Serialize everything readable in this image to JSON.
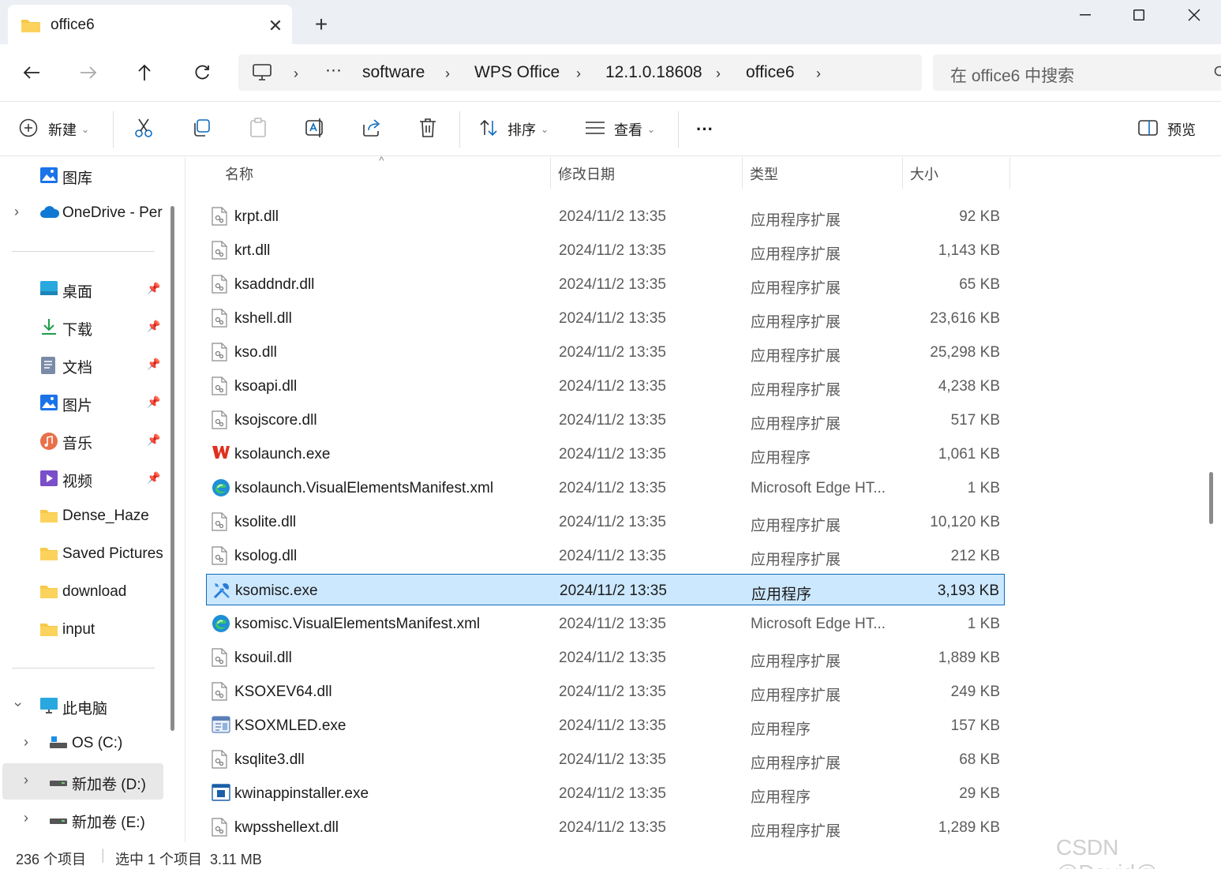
{
  "window": {
    "tab_title": "office6",
    "tab_close": "✕",
    "new_tab": "+"
  },
  "address": {
    "overflow": "···",
    "crumbs": [
      "software",
      "WPS Office",
      "12.1.0.18608",
      "office6"
    ],
    "search_placeholder": "在 office6 中搜索"
  },
  "commands": {
    "new": "新建",
    "sort": "排序",
    "view": "查看",
    "more": "···",
    "preview": "预览"
  },
  "sidebar": {
    "gallery": "图库",
    "onedrive": "OneDrive - Per",
    "quick": [
      {
        "label": "桌面",
        "icon": "desktop-icon"
      },
      {
        "label": "下载",
        "icon": "download-icon"
      },
      {
        "label": "文档",
        "icon": "document-icon"
      },
      {
        "label": "图片",
        "icon": "pictures-icon"
      },
      {
        "label": "音乐",
        "icon": "music-icon"
      },
      {
        "label": "视频",
        "icon": "video-icon"
      }
    ],
    "folders": [
      "Dense_Haze",
      "Saved Pictures",
      "download",
      "input"
    ],
    "this_pc": "此电脑",
    "drives": [
      "OS (C:)",
      "新加卷 (D:)",
      "新加卷 (E:)"
    ]
  },
  "columns": {
    "name": "名称",
    "date": "修改日期",
    "type": "类型",
    "size": "大小"
  },
  "files": [
    {
      "name": "krpt.dll",
      "date": "2024/11/2 13:35",
      "type": "应用程序扩展",
      "size": "92 KB",
      "icon": "dll"
    },
    {
      "name": "krt.dll",
      "date": "2024/11/2 13:35",
      "type": "应用程序扩展",
      "size": "1,143 KB",
      "icon": "dll"
    },
    {
      "name": "ksaddndr.dll",
      "date": "2024/11/2 13:35",
      "type": "应用程序扩展",
      "size": "65 KB",
      "icon": "dll"
    },
    {
      "name": "kshell.dll",
      "date": "2024/11/2 13:35",
      "type": "应用程序扩展",
      "size": "23,616 KB",
      "icon": "dll"
    },
    {
      "name": "kso.dll",
      "date": "2024/11/2 13:35",
      "type": "应用程序扩展",
      "size": "25,298 KB",
      "icon": "dll"
    },
    {
      "name": "ksoapi.dll",
      "date": "2024/11/2 13:35",
      "type": "应用程序扩展",
      "size": "4,238 KB",
      "icon": "dll"
    },
    {
      "name": "ksojscore.dll",
      "date": "2024/11/2 13:35",
      "type": "应用程序扩展",
      "size": "517 KB",
      "icon": "dll"
    },
    {
      "name": "ksolaunch.exe",
      "date": "2024/11/2 13:35",
      "type": "应用程序",
      "size": "1,061 KB",
      "icon": "wps"
    },
    {
      "name": "ksolaunch.VisualElementsManifest.xml",
      "date": "2024/11/2 13:35",
      "type": "Microsoft Edge HT...",
      "size": "1 KB",
      "icon": "edge"
    },
    {
      "name": "ksolite.dll",
      "date": "2024/11/2 13:35",
      "type": "应用程序扩展",
      "size": "10,120 KB",
      "icon": "dll"
    },
    {
      "name": "ksolog.dll",
      "date": "2024/11/2 13:35",
      "type": "应用程序扩展",
      "size": "212 KB",
      "icon": "dll"
    },
    {
      "name": "ksomisc.exe",
      "date": "2024/11/2 13:35",
      "type": "应用程序",
      "size": "3,193 KB",
      "icon": "tools",
      "selected": true
    },
    {
      "name": "ksomisc.VisualElementsManifest.xml",
      "date": "2024/11/2 13:35",
      "type": "Microsoft Edge HT...",
      "size": "1 KB",
      "icon": "edge"
    },
    {
      "name": "ksouil.dll",
      "date": "2024/11/2 13:35",
      "type": "应用程序扩展",
      "size": "1,889 KB",
      "icon": "dll"
    },
    {
      "name": "KSOXEV64.dll",
      "date": "2024/11/2 13:35",
      "type": "应用程序扩展",
      "size": "249 KB",
      "icon": "dll"
    },
    {
      "name": "KSOXMLED.exe",
      "date": "2024/11/2 13:35",
      "type": "应用程序",
      "size": "157 KB",
      "icon": "xmled"
    },
    {
      "name": "ksqlite3.dll",
      "date": "2024/11/2 13:35",
      "type": "应用程序扩展",
      "size": "68 KB",
      "icon": "dll"
    },
    {
      "name": "kwinappinstaller.exe",
      "date": "2024/11/2 13:35",
      "type": "应用程序",
      "size": "29 KB",
      "icon": "installer"
    },
    {
      "name": "kwpsshellext.dll",
      "date": "2024/11/2 13:35",
      "type": "应用程序扩展",
      "size": "1,289 KB",
      "icon": "dll"
    }
  ],
  "status": {
    "count": "236 个项目",
    "selection": "选中 1 个项目  3.11 MB"
  },
  "watermark": "CSDN @David@",
  "colors": {
    "accent": "#0f6cbd",
    "selection_bg": "#cce8ff",
    "folder": "#f7c948"
  }
}
